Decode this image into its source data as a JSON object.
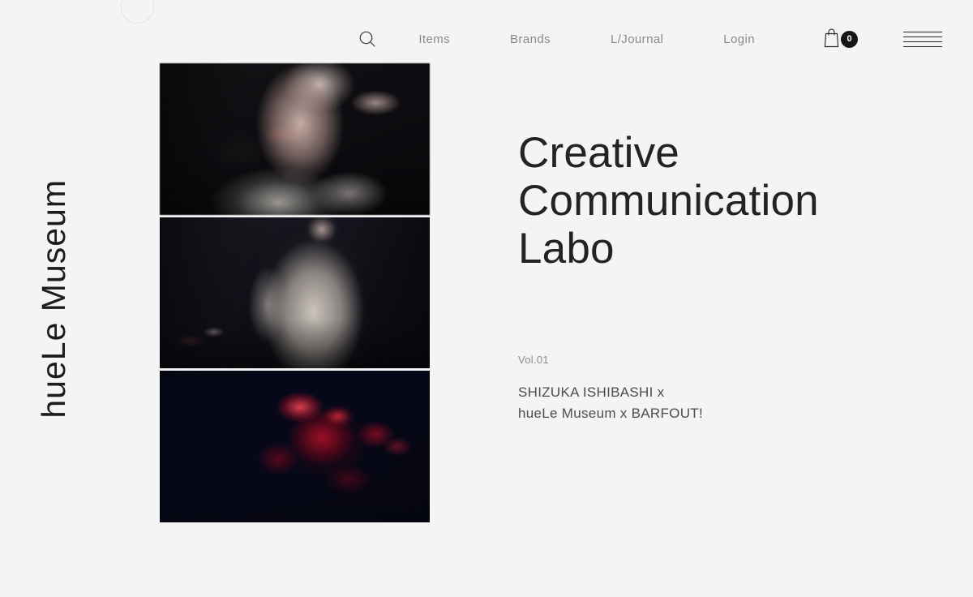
{
  "site": {
    "background_color": "#f4f4f4",
    "brand_vertical": "hueLe Museum"
  },
  "header": {
    "search_icon_label": "search-icon",
    "nav_links": [
      {
        "label": "Items"
      },
      {
        "label": "Brands"
      },
      {
        "label": "L/Journal"
      },
      {
        "label": "Login"
      }
    ],
    "cart": {
      "icon_label": "shopping-bag-icon",
      "count": "0"
    },
    "menu_toggle_label": "hamburger-menu-icon"
  },
  "gallery": {
    "items": [
      {
        "alt": "Blurred portrait of a woman in a white shirt against a dark background"
      },
      {
        "alt": "Figure in a long pale robe holding flowers in a dark studio"
      },
      {
        "alt": "Crimson red dahlia blossom on a deep navy-black background"
      }
    ]
  },
  "main": {
    "headline_lines": [
      "Creative",
      "Communication",
      "Labo"
    ],
    "volume": "Vol.01",
    "credit_lines": [
      "SHIZUKA ISHIBASHI x",
      "hueLe Museum x BARFOUT!"
    ]
  },
  "colors": {
    "text_dark": "#232323",
    "text_muted": "#8a8a8a",
    "badge_bg": "#161616",
    "badge_text": "#ffffff",
    "accent_red": "#b6102a"
  }
}
